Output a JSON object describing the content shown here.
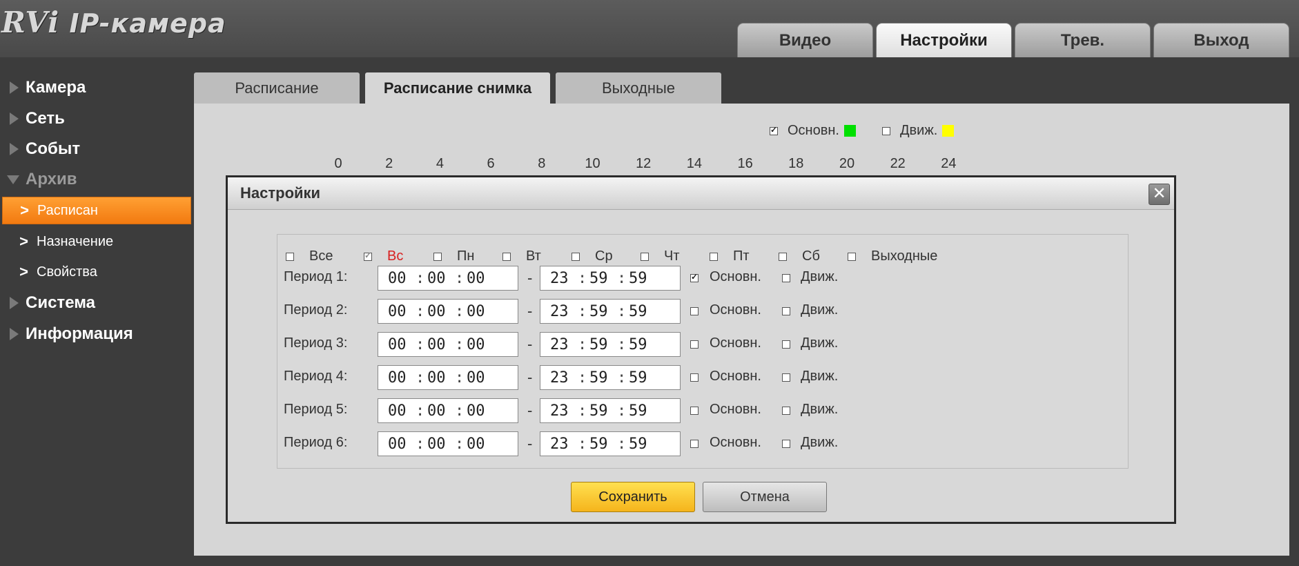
{
  "header": {
    "logo_brand": "RVi",
    "logo_text": "IP-камера",
    "tabs": [
      {
        "label": "Видео",
        "active": false
      },
      {
        "label": "Настройки",
        "active": true
      },
      {
        "label": "Трев.",
        "active": false
      },
      {
        "label": "Выход",
        "active": false
      }
    ]
  },
  "sidebar": {
    "items": [
      {
        "label": "Камера"
      },
      {
        "label": "Сеть"
      },
      {
        "label": "Событ"
      },
      {
        "label": "Архив"
      },
      {
        "label": "Система"
      },
      {
        "label": "Информация"
      }
    ],
    "subitems": [
      {
        "label": "Расписан",
        "active": true
      },
      {
        "label": "Назначение",
        "active": false
      },
      {
        "label": "Свойства",
        "active": false
      }
    ]
  },
  "subtabs": [
    {
      "label": "Расписание",
      "active": false
    },
    {
      "label": "Расписание снимка",
      "active": true
    },
    {
      "label": "Выходные",
      "active": false
    }
  ],
  "legend": {
    "main_label": "Основн.",
    "main_color": "#00e000",
    "main_checked": true,
    "motion_label": "Движ.",
    "motion_color": "#ffff00",
    "motion_checked": false
  },
  "scale": [
    "0",
    "2",
    "4",
    "6",
    "8",
    "10",
    "12",
    "14",
    "16",
    "18",
    "20",
    "22",
    "24"
  ],
  "dialog": {
    "title": "Настройки",
    "close_glyph": "✕",
    "days": [
      {
        "label": "Все",
        "checked": false
      },
      {
        "label": "Вс",
        "checked": true
      },
      {
        "label": "Пн",
        "checked": false
      },
      {
        "label": "Вт",
        "checked": false
      },
      {
        "label": "Ср",
        "checked": false
      },
      {
        "label": "Чт",
        "checked": false
      },
      {
        "label": "Пт",
        "checked": false
      },
      {
        "label": "Сб",
        "checked": false
      },
      {
        "label": "Выходные",
        "checked": false
      }
    ],
    "time_sep": ":",
    "range_sep": "-",
    "main_label": "Основн.",
    "motion_label": "Движ.",
    "periods": [
      {
        "label": "Период 1:",
        "start": [
          "00",
          "00",
          "00"
        ],
        "end": [
          "23",
          "59",
          "59"
        ],
        "main": true,
        "motion": false
      },
      {
        "label": "Период 2:",
        "start": [
          "00",
          "00",
          "00"
        ],
        "end": [
          "23",
          "59",
          "59"
        ],
        "main": false,
        "motion": false
      },
      {
        "label": "Период 3:",
        "start": [
          "00",
          "00",
          "00"
        ],
        "end": [
          "23",
          "59",
          "59"
        ],
        "main": false,
        "motion": false
      },
      {
        "label": "Период 4:",
        "start": [
          "00",
          "00",
          "00"
        ],
        "end": [
          "23",
          "59",
          "59"
        ],
        "main": false,
        "motion": false
      },
      {
        "label": "Период 5:",
        "start": [
          "00",
          "00",
          "00"
        ],
        "end": [
          "23",
          "59",
          "59"
        ],
        "main": false,
        "motion": false
      },
      {
        "label": "Период 6:",
        "start": [
          "00",
          "00",
          "00"
        ],
        "end": [
          "23",
          "59",
          "59"
        ],
        "main": false,
        "motion": false
      }
    ],
    "save_label": "Сохранить",
    "cancel_label": "Отмена"
  }
}
